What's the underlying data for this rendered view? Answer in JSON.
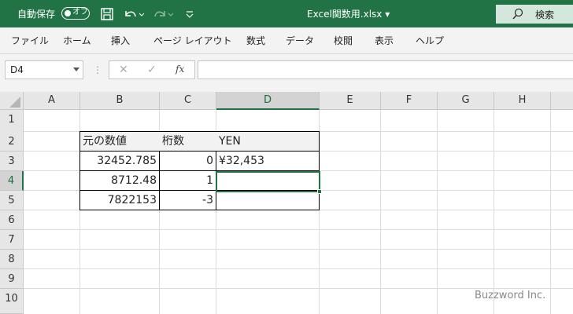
{
  "titlebar": {
    "autosave_label": "自動保存",
    "autosave_state": "オフ",
    "filename": "Excel関数用.xlsx ▾",
    "search_label": "検索",
    "icons": [
      "save-icon",
      "undo-icon",
      "redo-icon",
      "customize-qat-icon",
      "search-icon"
    ]
  },
  "menu": {
    "items": [
      "ファイル",
      "ホーム",
      "挿入",
      "ページ レイアウト",
      "数式",
      "データ",
      "校閲",
      "表示",
      "ヘルプ"
    ]
  },
  "formula_bar": {
    "name_box": "D4",
    "cancel_icon": "✕",
    "enter_icon": "✓",
    "fx_label": "fx",
    "value": ""
  },
  "sheet": {
    "columns": [
      "A",
      "B",
      "C",
      "D",
      "E",
      "F",
      "G",
      "H"
    ],
    "rows": [
      "1",
      "2",
      "3",
      "4",
      "5",
      "6",
      "7",
      "8",
      "9",
      "10"
    ],
    "selected_cell": "D4",
    "cells": {
      "B2": "元の数値",
      "C2": "桁数",
      "D2": "YEN",
      "B3": "32452.785",
      "C3": "0",
      "D3": "¥32,453",
      "B4": "8712.48",
      "C4": "1",
      "D4": "",
      "B5": "7822153",
      "C5": "-3",
      "D5": ""
    }
  },
  "watermark": "Buzzword Inc."
}
